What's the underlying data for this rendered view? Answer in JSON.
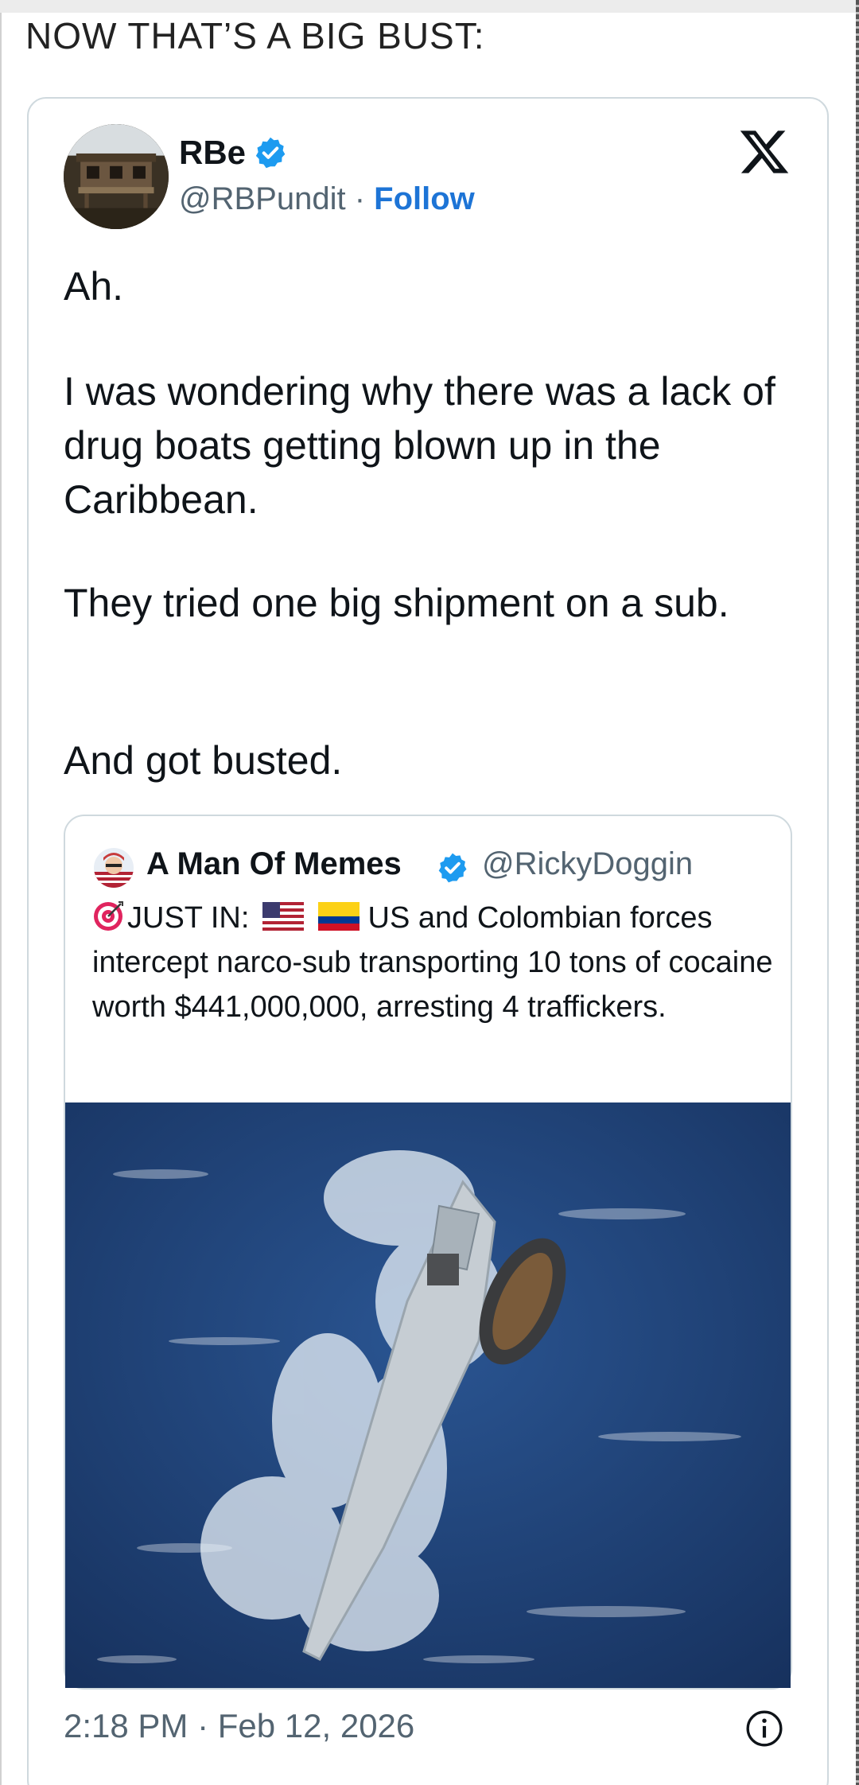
{
  "headline": "NOW THAT’S A BIG BUST:",
  "tweet": {
    "display_name": "RBe",
    "handle": "@RBPundit",
    "separator": " · ",
    "follow_label": "Follow",
    "paragraphs": [
      "Ah.",
      "I was wondering why there was a lack of drug boats getting blown up in the Caribbean.",
      "They tried one big shipment on a sub.",
      "And got busted."
    ],
    "timestamp": "2:18 PM · Feb 12, 2026"
  },
  "quoted_tweet": {
    "display_name": "A Man Of Memes",
    "handle": "@RickyDoggin",
    "lead": "JUST IN:",
    "text_rest": " US and Colombian forces intercept narco-sub transporting 10 tons of cocaine worth $441,000,000, arresting 4 traffickers."
  },
  "colors": {
    "verified": "#1d9bf0",
    "follow": "#1d74d6",
    "secondary_text": "#536471",
    "border": "#cfd9de",
    "ocean": "#1e3f72"
  },
  "icons": [
    "verified-badge-icon",
    "x-logo-icon",
    "target-icon",
    "us-flag-icon",
    "colombia-flag-icon",
    "info-icon"
  ]
}
